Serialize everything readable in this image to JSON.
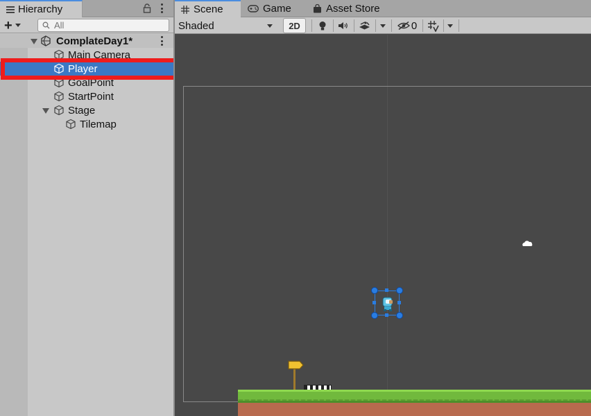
{
  "hierarchy": {
    "tab_label": "Hierarchy",
    "search_placeholder": "All",
    "rows": [
      {
        "label": "ComplateDay1*",
        "type": "scene"
      },
      {
        "label": "Main Camera"
      },
      {
        "label": "Player",
        "selected": true
      },
      {
        "label": "GoalPoint"
      },
      {
        "label": "StartPoint"
      },
      {
        "label": "Stage"
      },
      {
        "label": "Tilemap"
      }
    ]
  },
  "scene_view": {
    "tabs": [
      {
        "label": "Scene",
        "icon": "grid-icon",
        "active": true
      },
      {
        "label": "Game",
        "icon": "gamepad-icon"
      },
      {
        "label": "Asset Store",
        "icon": "shopping-bag-icon"
      }
    ],
    "shading_mode": "Shaded",
    "mode_2d_label": "2D",
    "hidden_objects_count": "0"
  },
  "colors": {
    "selection": "#3b78c4",
    "annotation_box": "#ee1c1c",
    "viewport_bg": "#484848",
    "gizmo_handle": "#2a7de1"
  }
}
